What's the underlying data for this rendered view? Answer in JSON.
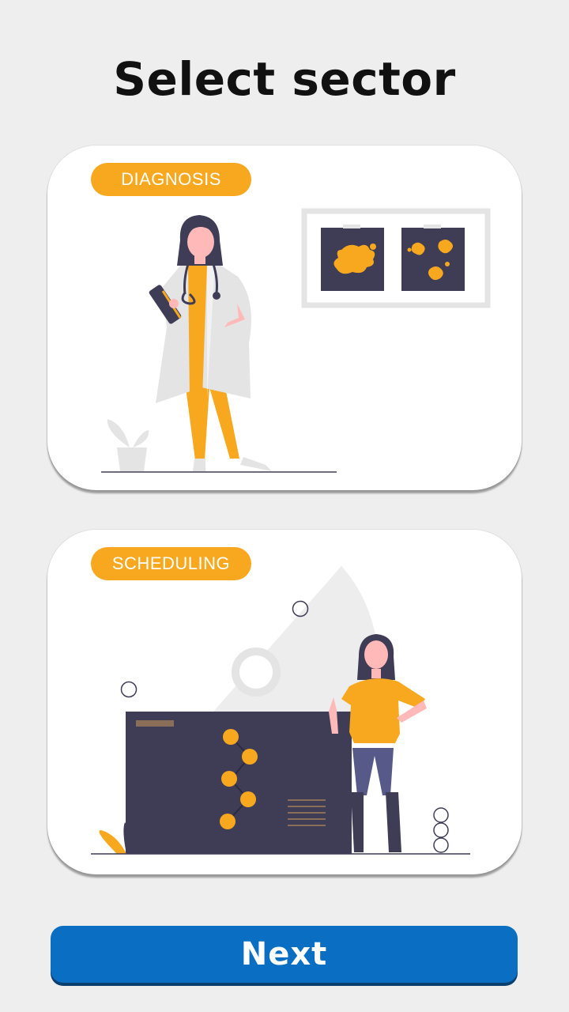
{
  "page": {
    "title": "Select sector"
  },
  "sectors": [
    {
      "label": "DIAGNOSIS"
    },
    {
      "label": "SCHEDULING"
    }
  ],
  "footer": {
    "next_label": "Next"
  },
  "colors": {
    "accent": "#f8a81e",
    "primary_button": "#0a6fc2",
    "dark": "#3f3d56",
    "background": "#eeeeee"
  }
}
